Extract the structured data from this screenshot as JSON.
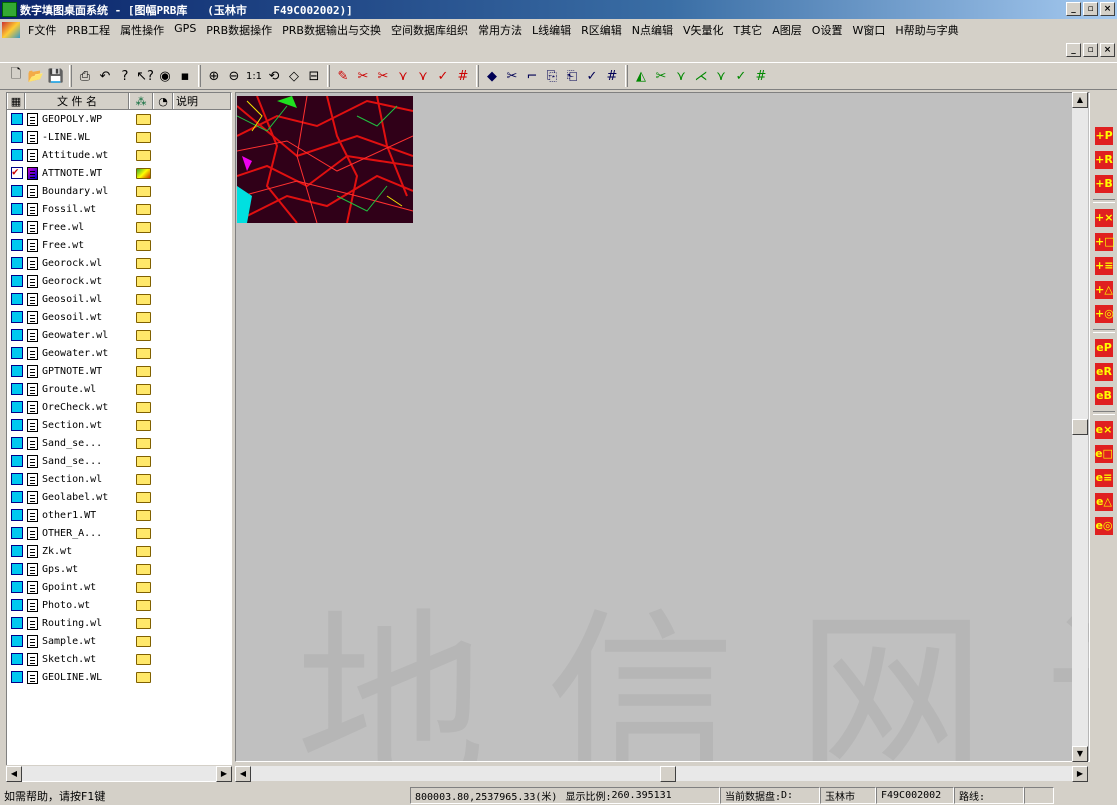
{
  "window": {
    "title": "数字填图桌面系统 - [图幅PRB库   (玉林市    F49C002002)]"
  },
  "menu": {
    "items": [
      "F文件",
      "PRB工程",
      "属性操作",
      "GPS",
      "PRB数据操作",
      "PRB数据输出与交换",
      "空间数据库组织",
      "常用方法",
      "L线编辑",
      "R区编辑",
      "N点编辑",
      "V矢量化",
      "T其它",
      "A图层",
      "O设置",
      "W窗口",
      "H帮助与字典"
    ]
  },
  "panel": {
    "col_filename": "文 件 名",
    "col_desc": "说明"
  },
  "files": [
    {
      "name": "GEOPOLY.WP",
      "checked": false
    },
    {
      "name": "-LINE.WL",
      "checked": false
    },
    {
      "name": "Attitude.wt",
      "checked": false
    },
    {
      "name": "ATTNOTE.WT",
      "checked": true
    },
    {
      "name": "Boundary.wl",
      "checked": false
    },
    {
      "name": "Fossil.wt",
      "checked": false
    },
    {
      "name": "Free.wl",
      "checked": false
    },
    {
      "name": "Free.wt",
      "checked": false
    },
    {
      "name": "Georock.wl",
      "checked": false
    },
    {
      "name": "Georock.wt",
      "checked": false
    },
    {
      "name": "Geosoil.wl",
      "checked": false
    },
    {
      "name": "Geosoil.wt",
      "checked": false
    },
    {
      "name": "Geowater.wl",
      "checked": false
    },
    {
      "name": "Geowater.wt",
      "checked": false
    },
    {
      "name": "GPTNOTE.WT",
      "checked": false
    },
    {
      "name": "Groute.wl",
      "checked": false
    },
    {
      "name": "OreCheck.wt",
      "checked": false
    },
    {
      "name": "Section.wt",
      "checked": false
    },
    {
      "name": "Sand_se...",
      "checked": false
    },
    {
      "name": "Sand_se...",
      "checked": false
    },
    {
      "name": "Section.wl",
      "checked": false
    },
    {
      "name": "Geolabel.wt",
      "checked": false
    },
    {
      "name": "other1.WT",
      "checked": false
    },
    {
      "name": "OTHER_A...",
      "checked": false
    },
    {
      "name": "Zk.wt",
      "checked": false
    },
    {
      "name": "Gps.wt",
      "checked": false
    },
    {
      "name": "Gpoint.wt",
      "checked": false
    },
    {
      "name": "Photo.wt",
      "checked": false
    },
    {
      "name": "Routing.wl",
      "checked": false
    },
    {
      "name": "Sample.wt",
      "checked": false
    },
    {
      "name": "Sketch.wt",
      "checked": false
    },
    {
      "name": "GEOLINE.WL",
      "checked": false
    }
  ],
  "canvas": {
    "watermark": "地信网论"
  },
  "right_toolbar": {
    "labels": [
      "+P",
      "+R",
      "+B",
      "+×",
      "+□",
      "+≡",
      "+△",
      "+◎",
      "eP",
      "eR",
      "eB",
      "e×",
      "e□",
      "e≡",
      "e△",
      "e◎"
    ]
  },
  "status": {
    "help": "如需帮助，请按F1键",
    "coords": "800003.80,2537965.33(米)",
    "scale_label": "显示比例:",
    "scale": "260.395131",
    "disk_label": "当前数据盘:",
    "disk": "D:",
    "city": "玉林市",
    "sheet": "F49C002002",
    "route_label": "路线:"
  },
  "colors": {
    "title_start": "#0a246a",
    "checkbox": "#00c8f0",
    "canvas_bg": "#c0c0c0"
  }
}
